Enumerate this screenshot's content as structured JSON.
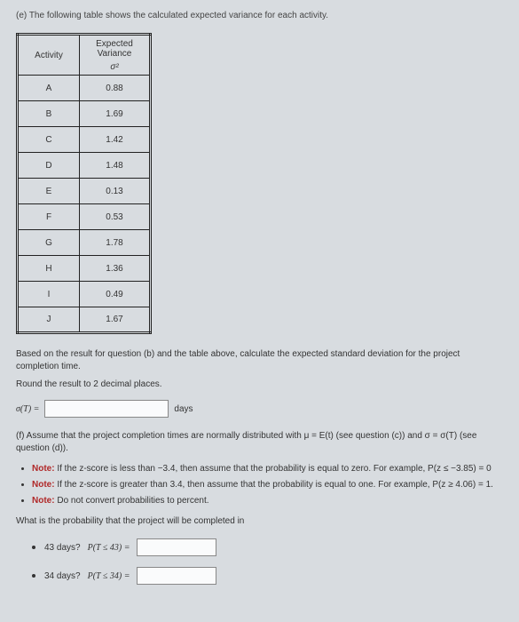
{
  "intro": "(e) The following table shows the calculated expected variance for each activity.",
  "table": {
    "header1": "Activity",
    "header2_line1": "Expected",
    "header2_line2": "Variance",
    "header2_symbol": "σ²",
    "rows": [
      {
        "activity": "A",
        "variance": "0.88"
      },
      {
        "activity": "B",
        "variance": "1.69"
      },
      {
        "activity": "C",
        "variance": "1.42"
      },
      {
        "activity": "D",
        "variance": "1.48"
      },
      {
        "activity": "E",
        "variance": "0.13"
      },
      {
        "activity": "F",
        "variance": "0.53"
      },
      {
        "activity": "G",
        "variance": "1.78"
      },
      {
        "activity": "H",
        "variance": "1.36"
      },
      {
        "activity": "I",
        "variance": "0.49"
      },
      {
        "activity": "J",
        "variance": "1.67"
      }
    ]
  },
  "after_table_1": "Based on the result for question (b) and the table above, calculate the expected standard deviation for the project completion time.",
  "after_table_2": "Round the result to 2 decimal places.",
  "sigma_lhs": "σ(T) =",
  "days_label": "days",
  "part_f": "(f) Assume that the project completion times are normally distributed with μ = E(t)  (see question (c)) and σ = σ(T) (see question (d)).",
  "notes": {
    "n1_pre": "Note:",
    "n1": " If the z-score is less than −3.4, then assume that the probability is equal to zero. For example, P(z ≤ −3.85) = 0",
    "n2_pre": "Note:",
    "n2": " If the z-score is greater than 3.4, then assume that the probability is equal to one. For example, P(z ≥ 4.06) = 1.",
    "n3_pre": "Note:",
    "n3": " Do not convert probabilities to percent."
  },
  "q_prompt": "What is the probability that the project will be completed in",
  "q43": {
    "label": "43 days?",
    "expr": "P(T ≤ 43) ="
  },
  "q34": {
    "label": "34 days?",
    "expr": "P(T ≤ 34) ="
  }
}
